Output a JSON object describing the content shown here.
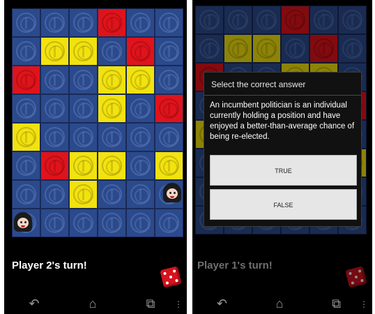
{
  "left_screen": {
    "board": [
      [
        "blue",
        "blue",
        "blue",
        "red",
        "blue",
        "blue"
      ],
      [
        "blue",
        "yellow",
        "yellow",
        "blue",
        "red",
        "blue"
      ],
      [
        "red",
        "blue",
        "blue",
        "yellow",
        "yellow",
        "blue"
      ],
      [
        "blue",
        "blue",
        "blue",
        "yellow",
        "blue",
        "red"
      ],
      [
        "yellow",
        "blue",
        "blue",
        "blue",
        "blue",
        "blue"
      ],
      [
        "blue",
        "red",
        "yellow",
        "yellow",
        "blue",
        "yellow"
      ],
      [
        "blue",
        "blue",
        "yellow",
        "blue",
        "blue",
        "blue"
      ],
      [
        "blue",
        "blue",
        "blue",
        "blue",
        "blue",
        "blue"
      ]
    ],
    "turn_text": "Player 2's turn!"
  },
  "right_screen": {
    "board": [
      [
        "blue",
        "blue",
        "blue",
        "red",
        "blue",
        "blue"
      ],
      [
        "blue",
        "yellow",
        "yellow",
        "blue",
        "red",
        "blue"
      ],
      [
        "red",
        "blue",
        "blue",
        "yellow",
        "yellow",
        "blue"
      ],
      [
        "blue",
        "blue",
        "blue",
        "yellow",
        "blue",
        "red"
      ],
      [
        "yellow",
        "blue",
        "blue",
        "blue",
        "blue",
        "blue"
      ],
      [
        "blue",
        "red",
        "yellow",
        "yellow",
        "blue",
        "yellow"
      ],
      [
        "blue",
        "blue",
        "yellow",
        "blue",
        "blue",
        "blue"
      ],
      [
        "blue",
        "blue",
        "blue",
        "blue",
        "blue",
        "blue"
      ]
    ],
    "turn_text": "Player 1's turn!",
    "dialog": {
      "title": "Select the correct answer",
      "message": "An incumbent politician is an individual currently holding a position and have enjoyed a better-than-average chance of being re-elected.",
      "true_label": "TRUE",
      "false_label": "FALSE"
    }
  },
  "colors": {
    "blue": "#2b4a8c",
    "yellow": "#f2e20f",
    "red": "#e0131b",
    "background": "#000000"
  },
  "icons": {
    "back": "back-arrow-icon",
    "home": "home-icon",
    "recents": "recent-apps-icon",
    "dice": "dice-icon",
    "avatar": "player-avatar-icon"
  }
}
